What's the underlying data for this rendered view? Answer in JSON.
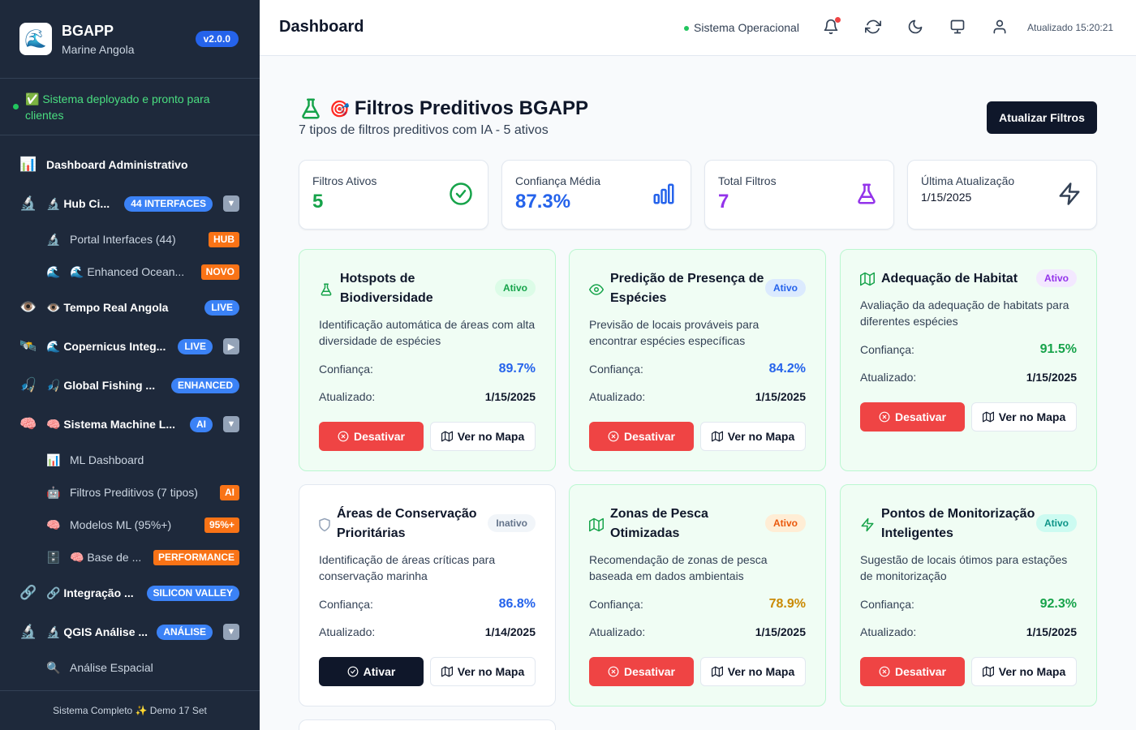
{
  "brand": {
    "logo": "🌊",
    "name": "BGAPP",
    "subtitle": "Marine Angola",
    "version": "v2.0.0"
  },
  "deploy_status": "✅ Sistema deployado e pronto para clientes",
  "sidebar": {
    "items": [
      {
        "icon": "📊",
        "label": "Dashboard Administrativo",
        "badge": "",
        "chevron": ""
      },
      {
        "icon": "🔬",
        "label": "🔬 Hub Ci...",
        "badge": "44 INTERFACES",
        "chevron": "▼"
      },
      {
        "icon": "🔬",
        "label": "Portal Interfaces (44)",
        "badge": "HUB",
        "chevron": ""
      },
      {
        "icon": "🌊",
        "label": "🌊 Enhanced Ocean...",
        "badge": "NOVO",
        "chevron": ""
      },
      {
        "icon": "👁️",
        "label": "👁️ Tempo Real Angola",
        "badge": "LIVE",
        "chevron": ""
      },
      {
        "icon": "🛰️",
        "label": "🌊 Copernicus Integ...",
        "badge": "LIVE",
        "chevron": "▶"
      },
      {
        "icon": "🎣",
        "label": "🎣 Global Fishing ...",
        "badge": "ENHANCED",
        "chevron": ""
      },
      {
        "icon": "🧠",
        "label": "🧠 Sistema Machine L...",
        "badge": "AI",
        "chevron": "▼"
      },
      {
        "icon": "📊",
        "label": "ML Dashboard",
        "badge": "",
        "chevron": ""
      },
      {
        "icon": "🤖",
        "label": "Filtros Preditivos (7 tipos)",
        "badge": "AI",
        "chevron": ""
      },
      {
        "icon": "🧠",
        "label": "Modelos ML (95%+)",
        "badge": "95%+",
        "chevron": ""
      },
      {
        "icon": "🗄️",
        "label": "🧠 Base de ...",
        "badge": "PERFORMANCE",
        "chevron": ""
      },
      {
        "icon": "🔗",
        "label": "🔗 Integração ...",
        "badge": "SILICON VALLEY",
        "chevron": ""
      },
      {
        "icon": "🔬",
        "label": "🔬 QGIS Análise ...",
        "badge": "ANÁLISE",
        "chevron": "▼"
      },
      {
        "icon": "🔍",
        "label": "Análise Espacial",
        "badge": "",
        "chevron": ""
      }
    ],
    "footer": "Sistema Completo ✨ Demo 17 Set"
  },
  "header": {
    "title": "Dashboard",
    "status": "Sistema Operacional",
    "updated": "Atualizado 15:20:21"
  },
  "section": {
    "emoji": "🎯",
    "title": "Filtros Preditivos BGAPP",
    "subtitle": "7 tipos de filtros preditivos com IA - 5 ativos",
    "refresh_label": "Atualizar Filtros"
  },
  "stats": [
    {
      "label": "Filtros Ativos",
      "value": "5",
      "color": "#16a34a",
      "icon": "check-circle-icon"
    },
    {
      "label": "Confiança Média",
      "value": "87.3%",
      "color": "#2563eb",
      "icon": "bar-chart-icon"
    },
    {
      "label": "Total Filtros",
      "value": "7",
      "color": "#9333ea",
      "icon": "flask-icon"
    },
    {
      "label": "Última Atualização",
      "value": "1/15/2025",
      "color": "#0f172a",
      "icon": "lightning-icon"
    }
  ],
  "labels": {
    "confidence": "Confiança:",
    "updated": "Atualizado:",
    "deactivate": "Desativar",
    "activate": "Ativar",
    "map": "Ver no Mapa"
  },
  "filters": [
    {
      "title": "Hotspots de Biodiversidade",
      "status": "Ativo",
      "desc": "Identificação automática de áreas com alta diversidade de espécies",
      "confidence": "89.7%",
      "conf_color": "#2563eb",
      "updated": "1/15/2025",
      "active": true,
      "icon": "flask-icon",
      "status_color": "#16a34a",
      "status_bg": "#dcfce7"
    },
    {
      "title": "Predição de Presença de Espécies",
      "status": "Ativo",
      "desc": "Previsão de locais prováveis para encontrar espécies específicas",
      "confidence": "84.2%",
      "conf_color": "#2563eb",
      "updated": "1/15/2025",
      "active": true,
      "icon": "eye-icon",
      "status_color": "#2563eb",
      "status_bg": "#dbeafe"
    },
    {
      "title": "Adequação de Habitat",
      "status": "Ativo",
      "desc": "Avaliação da adequação de habitats para diferentes espécies",
      "confidence": "91.5%",
      "conf_color": "#16a34a",
      "updated": "1/15/2025",
      "active": true,
      "icon": "map-icon",
      "status_color": "#9333ea",
      "status_bg": "#f3e8ff"
    },
    {
      "title": "Áreas de Conservação Prioritárias",
      "status": "Inativo",
      "desc": "Identificação de áreas críticas para conservação marinha",
      "confidence": "86.8%",
      "conf_color": "#2563eb",
      "updated": "1/14/2025",
      "active": false,
      "icon": "shield-icon",
      "status_color": "#64748b",
      "status_bg": "#f1f5f9"
    },
    {
      "title": "Zonas de Pesca Otimizadas",
      "status": "Ativo",
      "desc": "Recomendação de zonas de pesca baseada em dados ambientais",
      "confidence": "78.9%",
      "conf_color": "#ca8a04",
      "updated": "1/15/2025",
      "active": true,
      "icon": "map-icon",
      "status_color": "#ea580c",
      "status_bg": "#ffedd5"
    },
    {
      "title": "Pontos de Monitorização Inteligentes",
      "status": "Ativo",
      "desc": "Sugestão de locais ótimos para estações de monitorização",
      "confidence": "92.3%",
      "conf_color": "#16a34a",
      "updated": "1/15/2025",
      "active": true,
      "icon": "lightning-icon",
      "status_color": "#0d9488",
      "status_bg": "#ccfbf1"
    }
  ]
}
